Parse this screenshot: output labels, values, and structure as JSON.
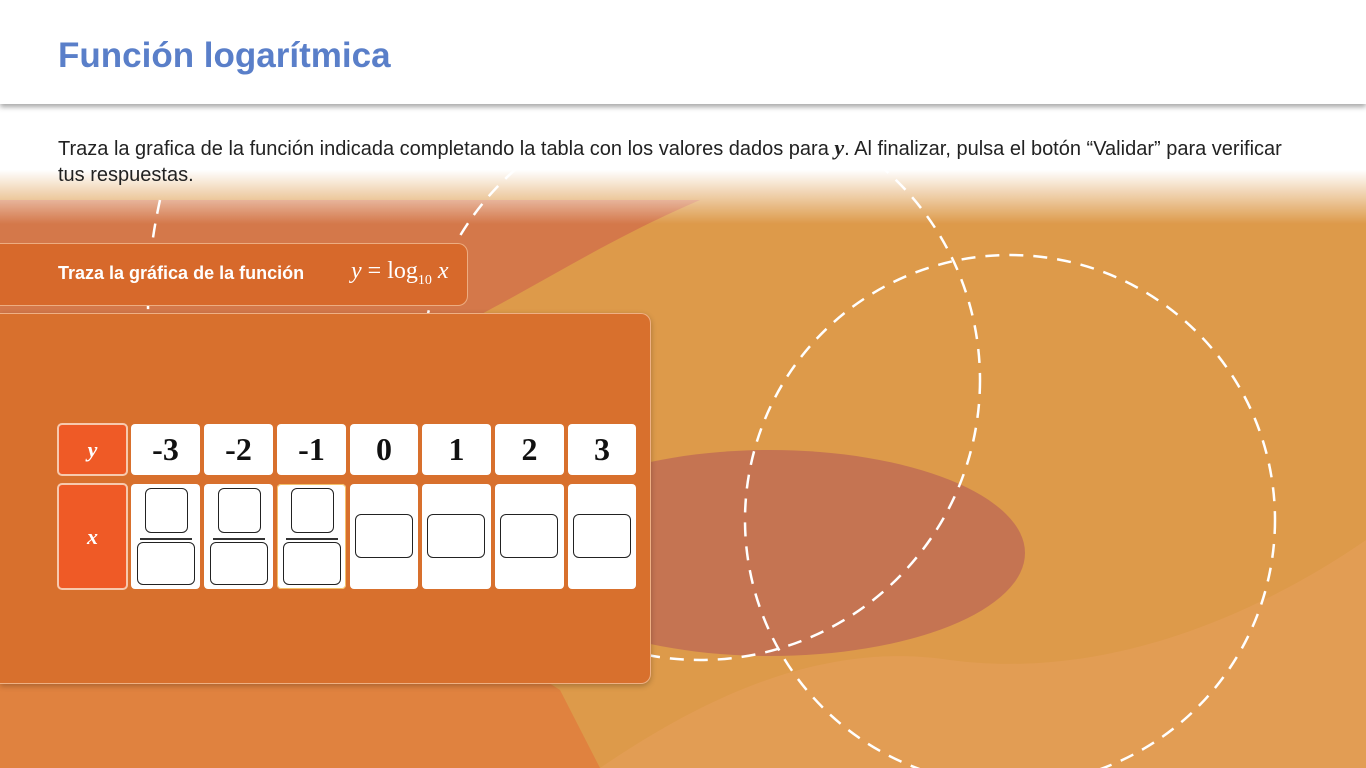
{
  "header": {
    "title": "Función logarítmica"
  },
  "instructions": {
    "text_before": "Traza la grafica de la función indicada completando la tabla con los valores dados para ",
    "variable": "y",
    "text_after": ". Al finalizar, pulsa el botón “Validar” para verificar tus respuestas."
  },
  "task": {
    "label": "Traza la gráfica de la función",
    "formula_y": "y",
    "formula_eq": " = log",
    "formula_base": "10",
    "formula_x": " x"
  },
  "table": {
    "y_header": "y",
    "x_header": "x",
    "y_values": [
      "-3",
      "-2",
      "-1",
      "0",
      "1",
      "2",
      "3"
    ],
    "x_inputs": [
      {
        "type": "fraction",
        "numerator": "",
        "denominator": ""
      },
      {
        "type": "fraction",
        "numerator": "",
        "denominator": ""
      },
      {
        "type": "fraction",
        "numerator": "",
        "denominator": ""
      },
      {
        "type": "single",
        "value": ""
      },
      {
        "type": "single",
        "value": ""
      },
      {
        "type": "single",
        "value": ""
      },
      {
        "type": "single",
        "value": ""
      }
    ]
  },
  "colors": {
    "title": "#5a7fc9",
    "header_cell": "#ef5a26",
    "panel": "#d8702d",
    "background": "#dd9a4a"
  }
}
